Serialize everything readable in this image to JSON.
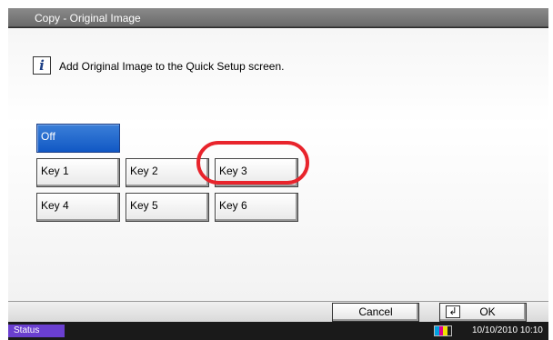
{
  "title": "Copy - Original Image",
  "info": {
    "icon": "info-icon",
    "glyph": "i",
    "message": "Add Original Image to the Quick Setup screen."
  },
  "options": {
    "off": "Off",
    "keys": [
      "Key 1",
      "Key 2",
      "Key 3",
      "Key 4",
      "Key 5",
      "Key 6"
    ],
    "selected": "Off",
    "highlighted": "Key 3"
  },
  "footer": {
    "cancel_label": "Cancel",
    "ok_label": "OK",
    "ok_icon_glyph": "↲"
  },
  "statusbar": {
    "status_label": "Status",
    "datetime": "10/10/2010  10:10"
  },
  "colors": {
    "accent_selected": "#1158c4",
    "highlight_ring": "#e8242c",
    "status_button": "#6a3fd0",
    "toner": [
      "#00a0e0",
      "#e0008a",
      "#f0e000",
      "#222222"
    ]
  }
}
